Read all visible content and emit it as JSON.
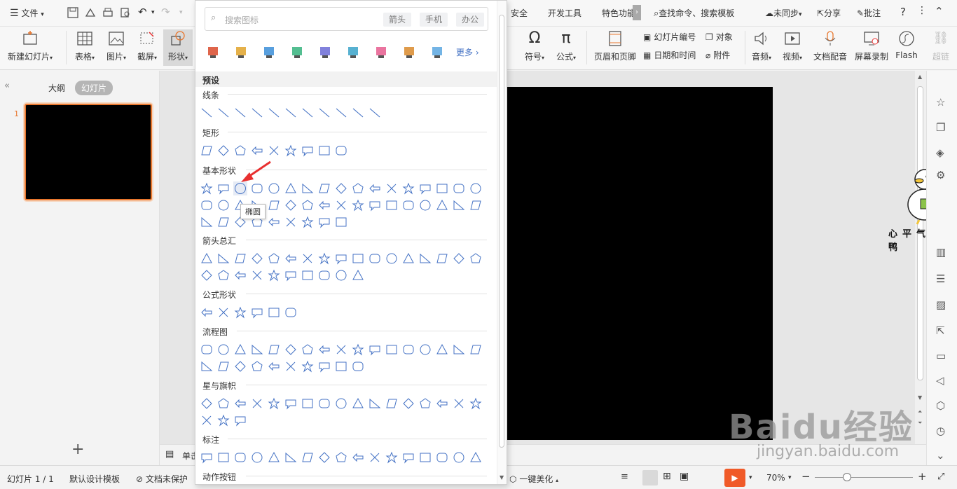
{
  "topbar": {
    "menu_label": "文件",
    "tabs": [
      "安全",
      "开发工具",
      "特色功能"
    ],
    "search_label": "查找命令、搜索模板",
    "sync_label": "未同步",
    "share_label": "分享",
    "comment_label": "批注",
    "help_label": "?"
  },
  "ribbon": {
    "new_slide": "新建幻灯片",
    "table": "表格",
    "picture": "图片",
    "screenshot": "截屏",
    "shape": "形状",
    "symbol": "符号",
    "formula": "公式",
    "header_footer": "页眉和页脚",
    "slide_number": "幻灯片编号",
    "object": "对象",
    "date_time": "日期和时间",
    "attachment": "附件",
    "audio": "音频",
    "video": "视频",
    "doc_voice": "文档配音",
    "screen_record": "屏幕录制",
    "flash": "Flash",
    "hyperlink": "超链"
  },
  "left_panel": {
    "outline_tab": "大纲",
    "slides_tab": "幻灯片",
    "slide_number": "1",
    "add": "+"
  },
  "popup": {
    "search_placeholder": "搜索图标",
    "chips": [
      "箭头",
      "手机",
      "办公"
    ],
    "more_label": "更多",
    "preset_label": "预设",
    "sections": [
      "线条",
      "矩形",
      "基本形状",
      "箭头总汇",
      "公式形状",
      "流程图",
      "星与旗帜",
      "标注",
      "动作按钮"
    ],
    "tooltip": "椭圆"
  },
  "notes": {
    "label": "单击"
  },
  "statusbar": {
    "slide_info": "幻灯片 1 / 1",
    "theme": "默认设计模板",
    "protect": "文档未保护",
    "beautify": "一键美化",
    "zoom": "70%"
  },
  "watermark": {
    "logo": "Baidu经验",
    "url": "jingyan.baidu.com",
    "sticker_text": "心平气和鸭"
  },
  "colors": {
    "accent": "#e8772e",
    "shape_stroke": "#4472c4",
    "play_button": "#f05a28"
  }
}
